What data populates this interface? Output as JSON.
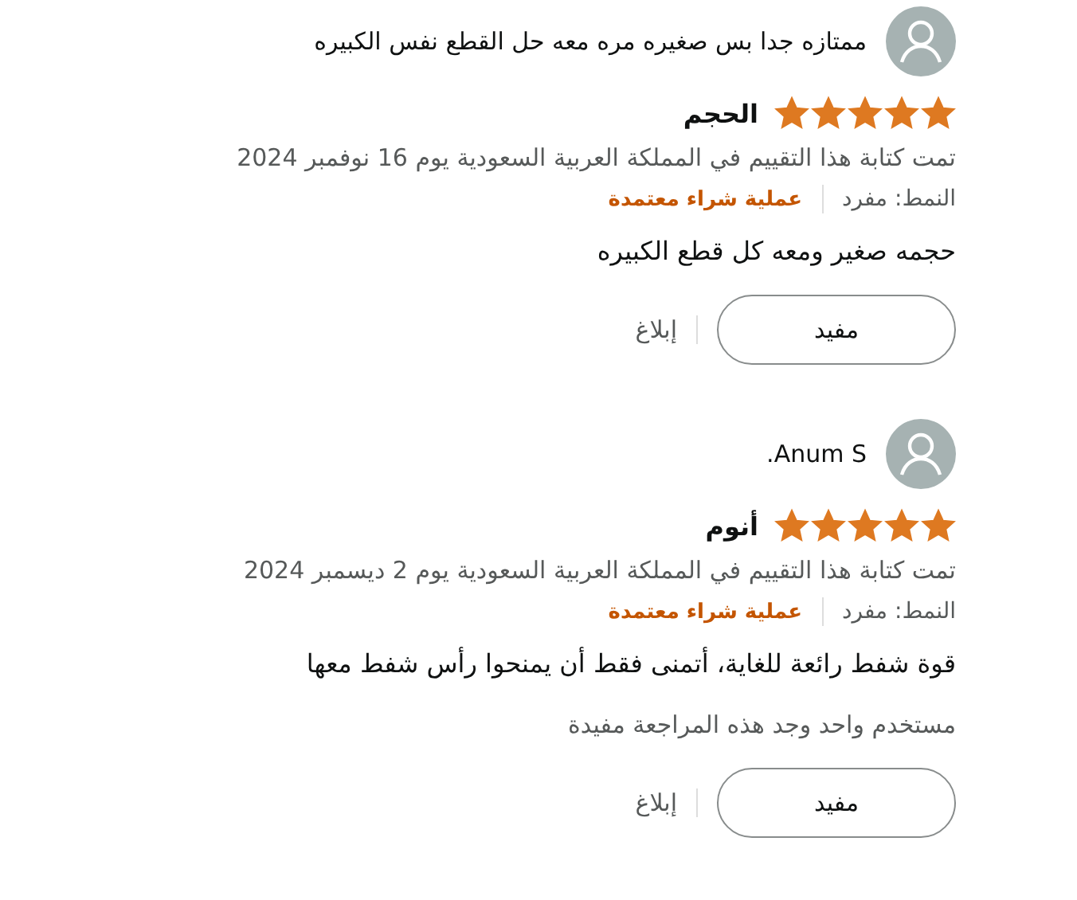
{
  "reviews": [
    {
      "author": "ممتازه جدا بس صغيره مره معه حل القطع نفس الكبيره",
      "stars": 5,
      "title": "الحجم",
      "date": "تمت كتابة هذا التقييم في المملكة العربية السعودية يوم 16 نوفمبر 2024",
      "style": "النمط: مفرد",
      "verified": "عملية شراء معتمدة",
      "body": "حجمه صغير ومعه كل قطع الكبيره",
      "helpful_button": "مفيد",
      "report": "إبلاغ"
    },
    {
      "author": "Anum S.",
      "stars": 5,
      "title": "أنوم",
      "date": "تمت كتابة هذا التقييم في المملكة العربية السعودية يوم 2 ديسمبر 2024",
      "style": "النمط: مفرد",
      "verified": "عملية شراء معتمدة",
      "body": "قوة شفط رائعة للغاية، أتمنى فقط أن يمنحوا رأس شفط معها",
      "helpful_count": "مستخدم واحد وجد هذه المراجعة مفيدة",
      "helpful_button": "مفيد",
      "report": "إبلاغ"
    }
  ]
}
